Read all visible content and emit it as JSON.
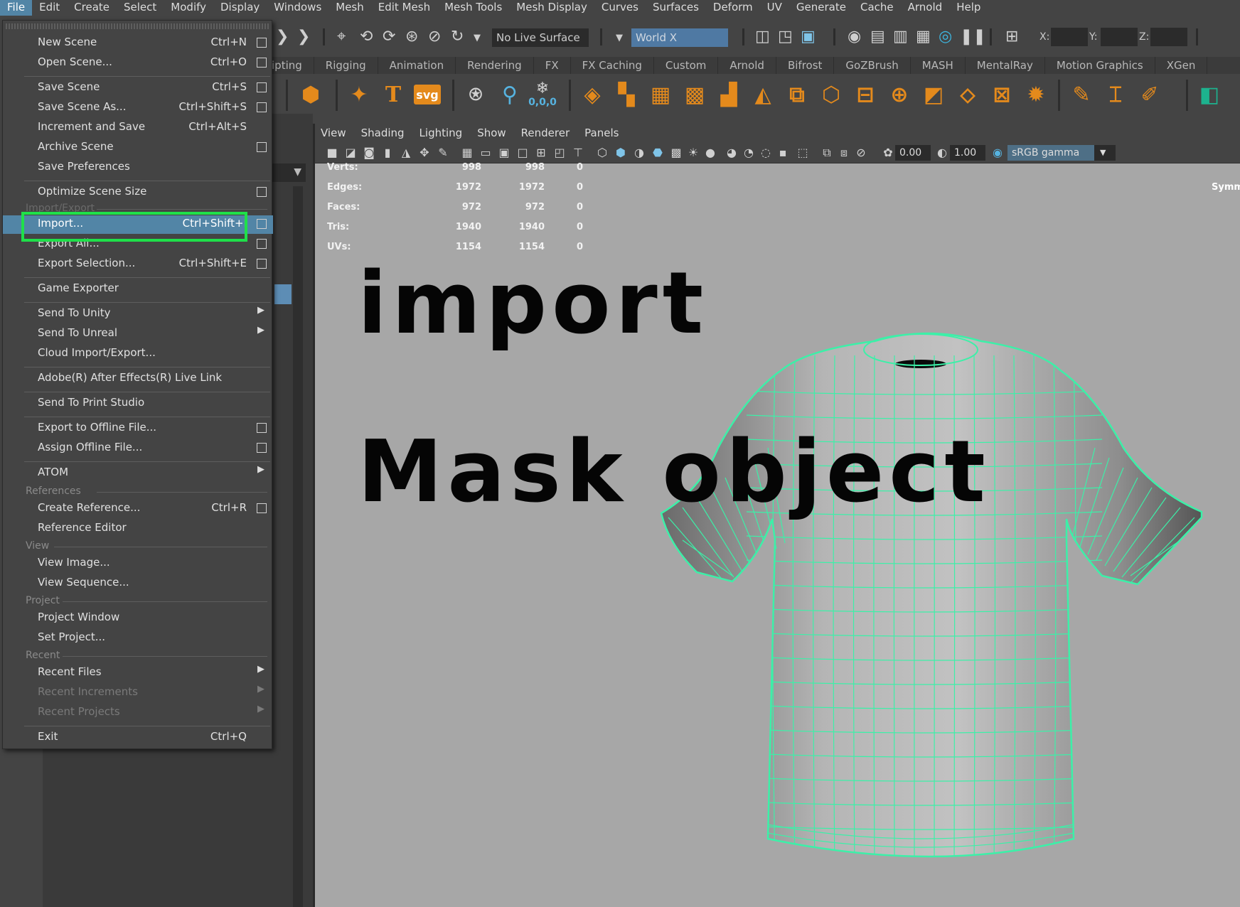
{
  "menubar": [
    "File",
    "Edit",
    "Create",
    "Select",
    "Modify",
    "Display",
    "Windows",
    "Mesh",
    "Edit Mesh",
    "Mesh Tools",
    "Mesh Display",
    "Curves",
    "Surfaces",
    "Deform",
    "UV",
    "Generate",
    "Cache",
    "Arnold",
    "Help"
  ],
  "statusline": {
    "live_surface": "No Live Surface",
    "space": "World X",
    "x_label": "X:",
    "y_label": "Y:",
    "z_label": "Z:"
  },
  "shelf_tabs": [
    "ipting",
    "Rigging",
    "Animation",
    "Rendering",
    "FX",
    "FX Caching",
    "Custom",
    "Arnold",
    "Bifrost",
    "GoZBrush",
    "MASH",
    "MentalRay",
    "Motion Graphics",
    "XGen"
  ],
  "shelf_text": {
    "t": "T",
    "svg": "svg",
    "coords": "0,0,0"
  },
  "panel_menu": [
    "View",
    "Shading",
    "Lighting",
    "Show",
    "Renderer",
    "Panels"
  ],
  "panel_toolbar": {
    "exposure": "0.00",
    "gamma": "1.00",
    "colorspace": "sRGB gamma"
  },
  "hud": {
    "rows": [
      {
        "label": "Verts:",
        "v1": "998",
        "v2": "998",
        "v3": "0"
      },
      {
        "label": "Edges:",
        "v1": "1972",
        "v2": "1972",
        "v3": "0"
      },
      {
        "label": "Faces:",
        "v1": "972",
        "v2": "972",
        "v3": "0"
      },
      {
        "label": "Tris:",
        "v1": "1940",
        "v2": "1940",
        "v3": "0"
      },
      {
        "label": "UVs:",
        "v1": "1154",
        "v2": "1154",
        "v3": "0"
      }
    ],
    "symmetry": "Symm"
  },
  "overlay": {
    "line1": "import",
    "line2": "Mask object"
  },
  "file_menu": {
    "items": {
      "new_scene": {
        "label": "New Scene",
        "shortcut": "Ctrl+N"
      },
      "open_scene": {
        "label": "Open Scene...",
        "shortcut": "Ctrl+O"
      },
      "save_scene": {
        "label": "Save Scene",
        "shortcut": "Ctrl+S"
      },
      "save_scene_as": {
        "label": "Save Scene As...",
        "shortcut": "Ctrl+Shift+S"
      },
      "increment_save": {
        "label": "Increment and Save",
        "shortcut": "Ctrl+Alt+S"
      },
      "archive_scene": {
        "label": "Archive Scene"
      },
      "save_prefs": {
        "label": "Save Preferences"
      },
      "optimize": {
        "label": "Optimize Scene Size"
      },
      "import": {
        "label": "Import...",
        "shortcut": "Ctrl+Shift+I"
      },
      "export_all": {
        "label": "Export All..."
      },
      "export_selection": {
        "label": "Export Selection...",
        "shortcut": "Ctrl+Shift+E"
      },
      "game_exporter": {
        "label": "Game Exporter"
      },
      "send_unity": {
        "label": "Send To Unity"
      },
      "send_unreal": {
        "label": "Send To Unreal"
      },
      "cloud_import": {
        "label": "Cloud Import/Export..."
      },
      "after_effects": {
        "label": "Adobe(R) After Effects(R) Live Link"
      },
      "print_studio": {
        "label": "Send To Print Studio"
      },
      "export_offline": {
        "label": "Export to Offline File..."
      },
      "assign_offline": {
        "label": "Assign Offline File..."
      },
      "atom": {
        "label": "ATOM"
      },
      "create_reference": {
        "label": "Create Reference...",
        "shortcut": "Ctrl+R"
      },
      "reference_editor": {
        "label": "Reference Editor"
      },
      "view_image": {
        "label": "View Image..."
      },
      "view_sequence": {
        "label": "View Sequence..."
      },
      "project_window": {
        "label": "Project Window"
      },
      "set_project": {
        "label": "Set Project..."
      },
      "recent_files": {
        "label": "Recent Files"
      },
      "recent_increments": {
        "label": "Recent Increments"
      },
      "recent_projects": {
        "label": "Recent Projects"
      },
      "exit": {
        "label": "Exit",
        "shortcut": "Ctrl+Q"
      }
    },
    "sections": {
      "import_export": "Import/Export",
      "references": "References",
      "view": "View",
      "project": "Project",
      "recent": "Recent"
    }
  },
  "colors": {
    "highlight": "#5285a6",
    "wireframe": "#3cf0a8",
    "callout": "#1fe04a",
    "viewport_bg": "#a7a7a7"
  }
}
